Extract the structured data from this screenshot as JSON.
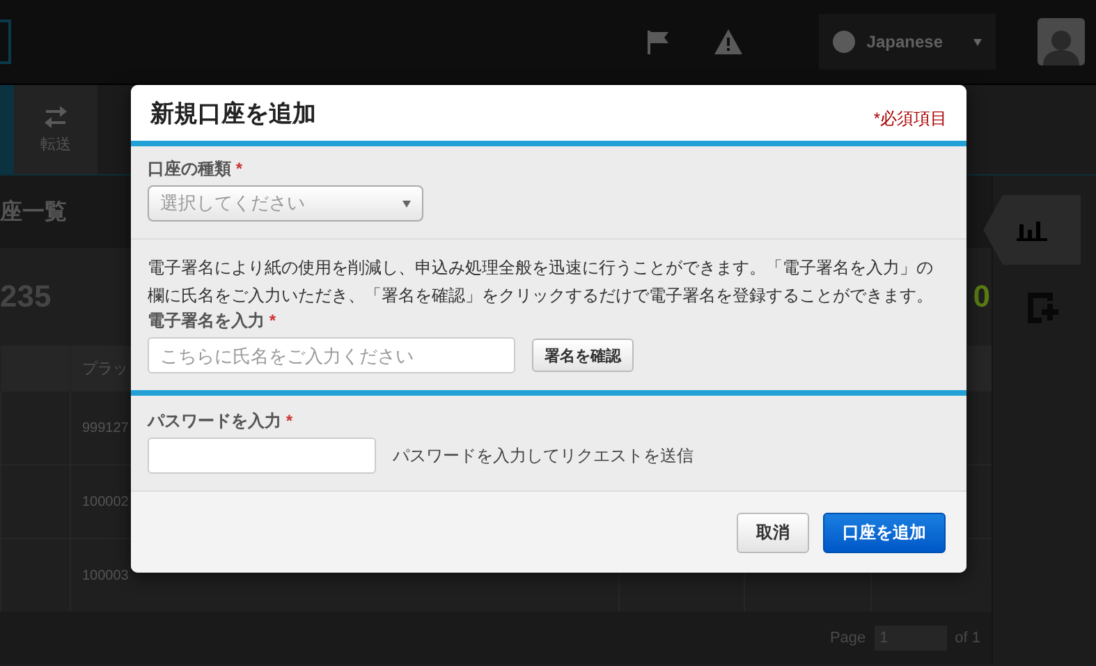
{
  "top_bar": {
    "language": "Japanese"
  },
  "nav": {
    "items": [
      {
        "label": "転送",
        "selected": false
      }
    ]
  },
  "page": {
    "title": "座一覧",
    "total": "235",
    "count": "0",
    "table": {
      "columns": [
        "プラッ"
      ],
      "rows": [
        [
          "999127"
        ],
        [
          "100002"
        ],
        [
          "100003"
        ]
      ]
    },
    "pagination": {
      "label": "Page",
      "page": "1",
      "of": "of 1"
    }
  },
  "modal": {
    "title": "新規口座を追加",
    "required_note": "*必須項目",
    "account_type": {
      "label": "口座の種類",
      "required_mark": "*",
      "placeholder": "選択してください"
    },
    "description": "電子署名により紙の使用を削減し、申込み処理全般を迅速に行うことができます。「電子署名を入力」の欄に氏名をご入力いただき、「署名を確認」をクリックするだけで電子署名を登録することができます。",
    "signature": {
      "label": "電子署名を入力",
      "required_mark": "*",
      "placeholder": "こちらに氏名をご入力ください",
      "button": "署名を確認"
    },
    "password": {
      "label": "パスワードを入力",
      "required_mark": "*",
      "hint": "パスワードを入力してリクエストを送信"
    },
    "buttons": [
      {
        "label": "取消",
        "kind": "secondary"
      },
      {
        "label": "口座を追加",
        "kind": "primary"
      }
    ]
  }
}
